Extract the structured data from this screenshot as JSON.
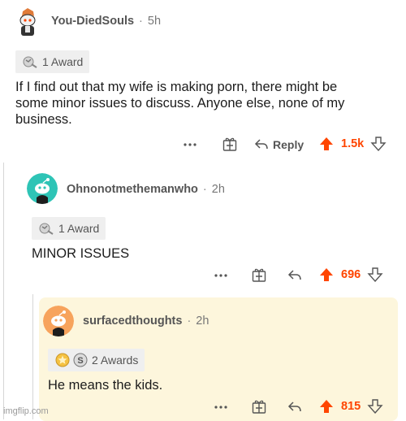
{
  "comments": [
    {
      "username": "You-DiedSouls",
      "time": "5h",
      "award": "1 Award",
      "text_lines": [
        "If I find out that my wife is making porn, there might be",
        "some minor issues to discuss. Anyone else, none of my",
        "business."
      ],
      "reply_label": "Reply",
      "score": "1.5k"
    },
    {
      "username": "Ohnonotmethemanwho",
      "time": "2h",
      "award": "1 Award",
      "text": "MINOR ISSUES",
      "score": "696"
    },
    {
      "username": "surfacedthoughts",
      "time": "2h",
      "award": "2 Awards",
      "text": "He means the kids.",
      "score": "815"
    }
  ],
  "icons": {
    "more": "more-dots",
    "gift": "gift-award",
    "reply": "reply-arrow",
    "upvote": "upvote-arrow",
    "downvote": "downvote-arrow"
  },
  "colors": {
    "upvote": "#ff4500",
    "avatar2": "#2ec4b6",
    "avatar3": "#f7a35c",
    "highlight": "#fdf6dc"
  },
  "watermark": "imgflip.com"
}
